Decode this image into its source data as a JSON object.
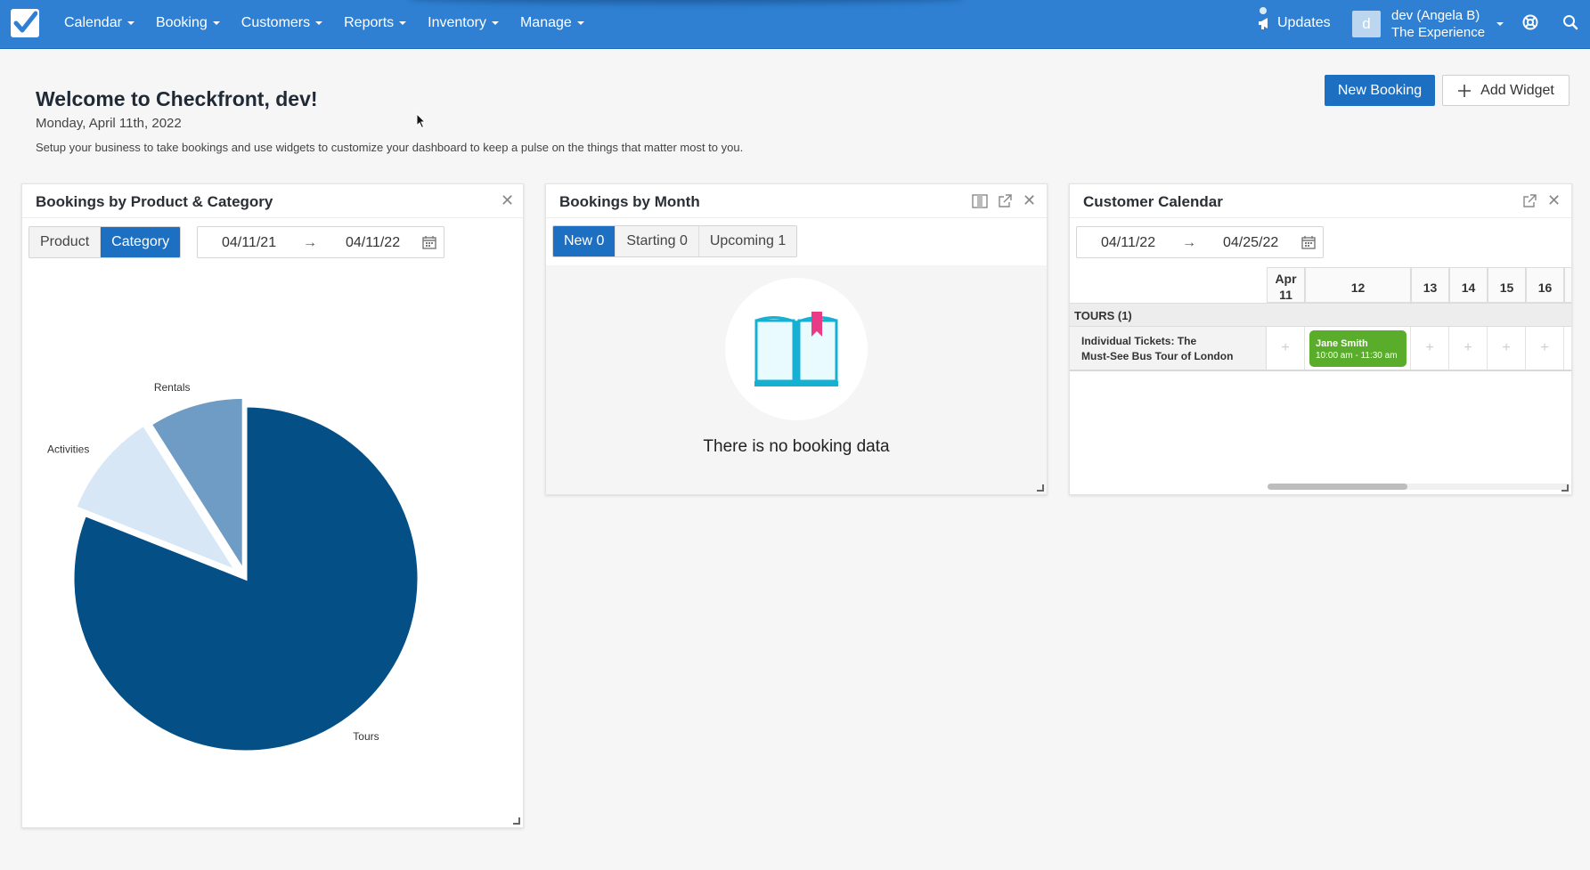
{
  "nav": {
    "items": [
      "Calendar",
      "Booking",
      "Customers",
      "Reports",
      "Inventory",
      "Manage"
    ],
    "updates_label": "Updates",
    "avatar_letter": "d",
    "user_name": "dev (Angela B)",
    "company": "The Experience"
  },
  "header": {
    "welcome": "Welcome to Checkfront, dev!",
    "date": "Monday, April 11th, 2022",
    "subtext": "Setup your business to take bookings and use widgets to customize your dashboard to keep a pulse on the things that matter most to you.",
    "new_booking": "New Booking",
    "add_widget": "Add Widget"
  },
  "widget_product": {
    "title": "Bookings by Product & Category",
    "tabs": [
      "Product",
      "Category"
    ],
    "active_tab": "Category",
    "date_from": "04/11/21",
    "date_to": "04/11/22"
  },
  "chart_data": {
    "type": "pie",
    "categories": [
      "Tours",
      "Activities",
      "Rentals"
    ],
    "values": [
      81,
      10,
      9
    ],
    "colors": [
      "#034f86",
      "#d7e7f6",
      "#6f9cc4"
    ],
    "title": ""
  },
  "widget_month": {
    "title": "Bookings by Month",
    "tabs": [
      "New 0",
      "Starting 0",
      "Upcoming 1"
    ],
    "active_tab": "New 0",
    "empty_text": "There is no booking data"
  },
  "widget_calendar": {
    "title": "Customer Calendar",
    "date_from": "04/11/22",
    "date_to": "04/25/22",
    "days": [
      {
        "num": "11",
        "month": "Apr"
      },
      {
        "num": "12"
      },
      {
        "num": "13"
      },
      {
        "num": "14"
      },
      {
        "num": "15"
      },
      {
        "num": "16"
      }
    ],
    "group": "TOURS (1)",
    "item_name_line1": "Individual Tickets: The",
    "item_name_line2": "Must-See Bus Tour of London",
    "booking_name": "Jane Smith",
    "booking_time": "10:00 am - 11:30 am"
  },
  "colors": {
    "topbar": "#2f80d2",
    "primary": "#1d6fc2",
    "booking_green": "#5aad2b"
  }
}
